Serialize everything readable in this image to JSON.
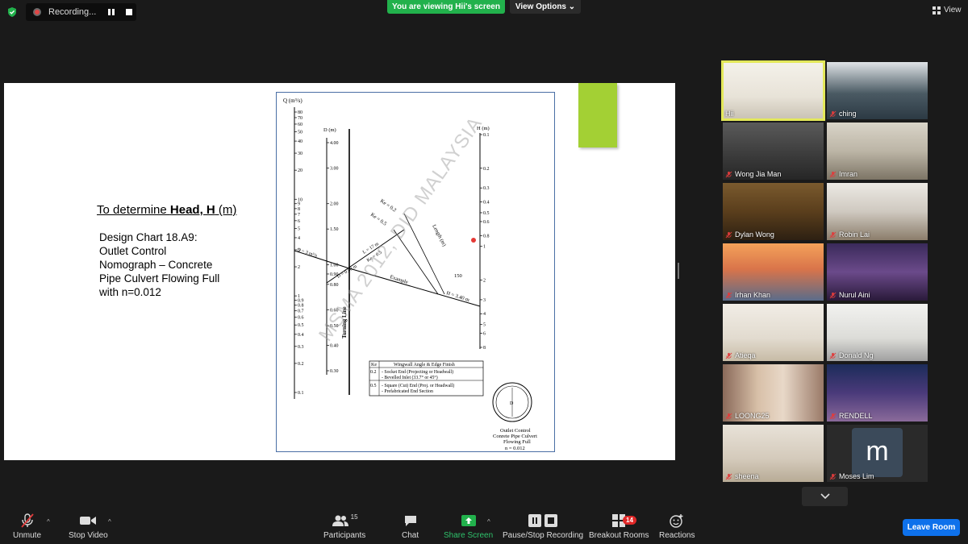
{
  "top_bar": {
    "recording_label": "Recording...",
    "viewing_banner": "You are viewing Hii's screen",
    "view_options_label": "View Options",
    "view_label": "View"
  },
  "slide": {
    "title_prefix": "To determine ",
    "title_bold": "Head, H",
    "title_suffix": " (m)",
    "description": [
      "Design Chart 18.A9:",
      "Outlet Control",
      "Nomograph – Concrete",
      "Pipe Culvert Flowing Full",
      "with n=0.012"
    ],
    "accent_color": "#a3d034"
  },
  "nomograph": {
    "q_axis_label": "Q (m³/s)",
    "q_ticks": [
      "80",
      "70",
      "60",
      "50",
      "40",
      "30",
      "20",
      "10",
      "9",
      "8",
      "7",
      "6",
      "5",
      "4",
      "3",
      "2",
      "1",
      "0.9",
      "0.8",
      "0.7",
      "0.6",
      "0.5",
      "0.4",
      "0.3",
      "0.2",
      "0.1"
    ],
    "d_axis_label": "D (m)",
    "d_ticks": [
      "4.00",
      "3.00",
      "2.00",
      "1.50",
      "1.00",
      "0.90",
      "0.80",
      "0.60",
      "0.50",
      "0.40",
      "0.30"
    ],
    "h_axis_label": "H (m)",
    "h_ticks": [
      "0.1",
      "0.2",
      "0.3",
      "0.4",
      "0.5",
      "0.6",
      "0.8",
      "1",
      "2",
      "3",
      "4",
      "5",
      "6",
      "8"
    ],
    "turning_line_label": "Turning Line",
    "ke_labels": [
      "Ke = 0.2",
      "Ke = 0.5"
    ],
    "length_label": "Length (m)",
    "example_label": "Example",
    "example_q": "Q = 3 m³/s",
    "example_d": "D = 0.90 m",
    "example_l": "L = 17 m",
    "example_ke": "Ke = 0.5",
    "example_h": "H = 3.40 m",
    "length_ticks": [
      "150"
    ],
    "table_header_ke": "Ke",
    "table_header_desc": "Wingwall Angle & Edge Finish",
    "table_rows": [
      {
        "ke": "0.2",
        "lines": [
          "- Socket End (Projecting or Headwall)",
          "- Bevelled Inlet (33.7° or 45°)"
        ]
      },
      {
        "ke": "0.5",
        "lines": [
          "- Square (Cut) End (Proj. or Headwall)",
          "- Prefabricated End Section"
        ]
      }
    ],
    "pipe_label": "D",
    "pipe_caption": [
      "Outlet Control",
      "Conrete Pipe Culvert",
      "Flowing Full",
      "n = 0.012"
    ],
    "watermark": "MSMA 2012, DID MALAYSIA"
  },
  "participants": [
    {
      "name": "Hii",
      "muted": false,
      "active": true,
      "scene": "bookshelf"
    },
    {
      "name": "ching",
      "muted": true,
      "active": false,
      "scene": "bookshelf-dark"
    },
    {
      "name": "Wong Jia Man",
      "muted": true,
      "active": false,
      "scene": "dim"
    },
    {
      "name": "Imran",
      "muted": true,
      "active": false,
      "scene": "office"
    },
    {
      "name": "Dylan Wong",
      "muted": true,
      "active": false,
      "scene": "library"
    },
    {
      "name": "Robin Lai",
      "muted": true,
      "active": false,
      "scene": "closeup"
    },
    {
      "name": "Irhan Khan",
      "muted": true,
      "active": false,
      "scene": "bridge"
    },
    {
      "name": "Nurul Aini",
      "muted": true,
      "active": false,
      "scene": "purple-room"
    },
    {
      "name": "Atieqa",
      "muted": true,
      "active": false,
      "scene": "wall"
    },
    {
      "name": "Donald Ng",
      "muted": true,
      "active": false,
      "scene": "office-man"
    },
    {
      "name": "LOONG25",
      "muted": true,
      "active": false,
      "scene": "curtains"
    },
    {
      "name": "RENDELL",
      "muted": true,
      "active": false,
      "scene": "night-sky"
    },
    {
      "name": "sheena",
      "muted": true,
      "active": false,
      "scene": "room"
    },
    {
      "name": "Moses Lim",
      "muted": true,
      "active": false,
      "scene": "avatar",
      "initial": "m"
    }
  ],
  "toolbar": {
    "unmute": "Unmute",
    "stop_video": "Stop Video",
    "participants": "Participants",
    "participants_count": "15",
    "chat": "Chat",
    "share_screen": "Share Screen",
    "recording": "Pause/Stop Recording",
    "breakout": "Breakout Rooms",
    "breakout_badge": "14",
    "reactions": "Reactions",
    "leave": "Leave Room"
  },
  "colors": {
    "share_green": "#22b14c",
    "leave_blue": "#0e71eb",
    "active_speaker": "#e3e85a",
    "badge_red": "#e02828"
  }
}
